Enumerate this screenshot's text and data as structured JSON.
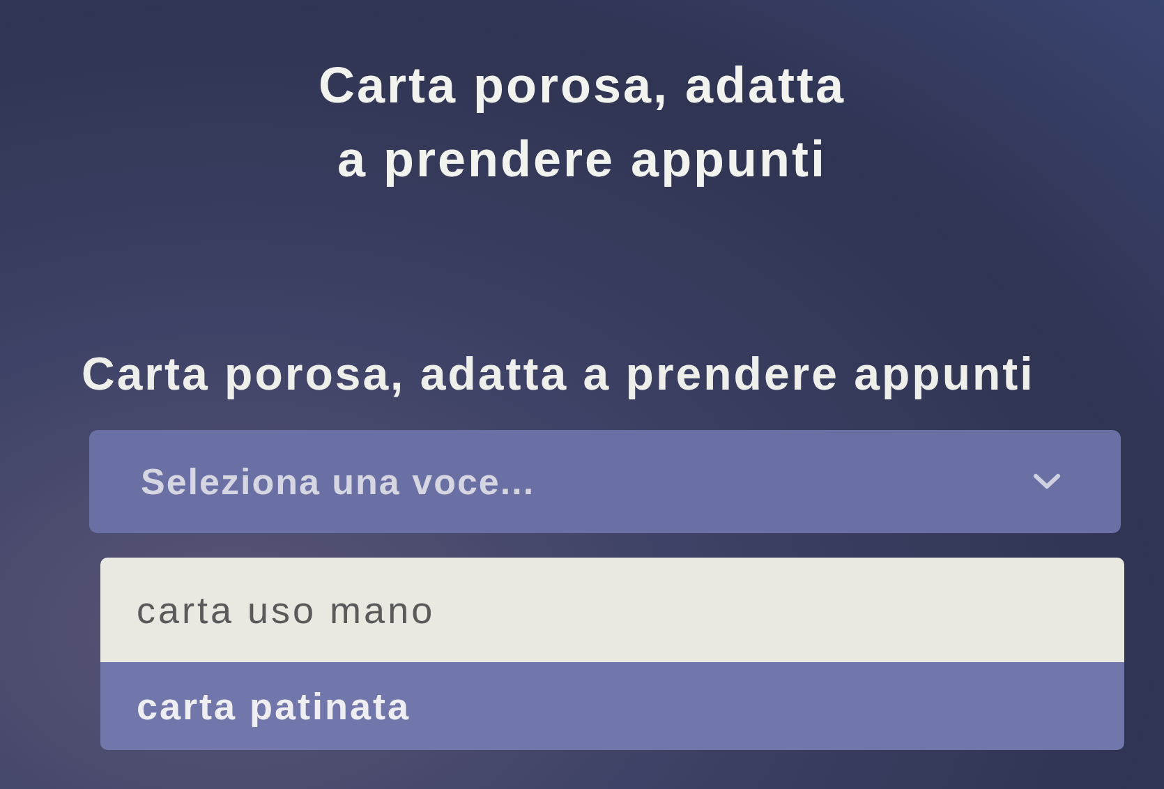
{
  "title": {
    "lines": [
      "Carta porosa, adatta",
      "a prendere appunti"
    ]
  },
  "question": {
    "label": "Carta porosa, adatta a prendere appunti",
    "select": {
      "placeholder": "Seleziona una voce...",
      "expanded": true
    },
    "options": [
      {
        "label": "carta uso mano",
        "selected": true
      },
      {
        "label": "carta patinata",
        "selected": false
      }
    ]
  }
}
